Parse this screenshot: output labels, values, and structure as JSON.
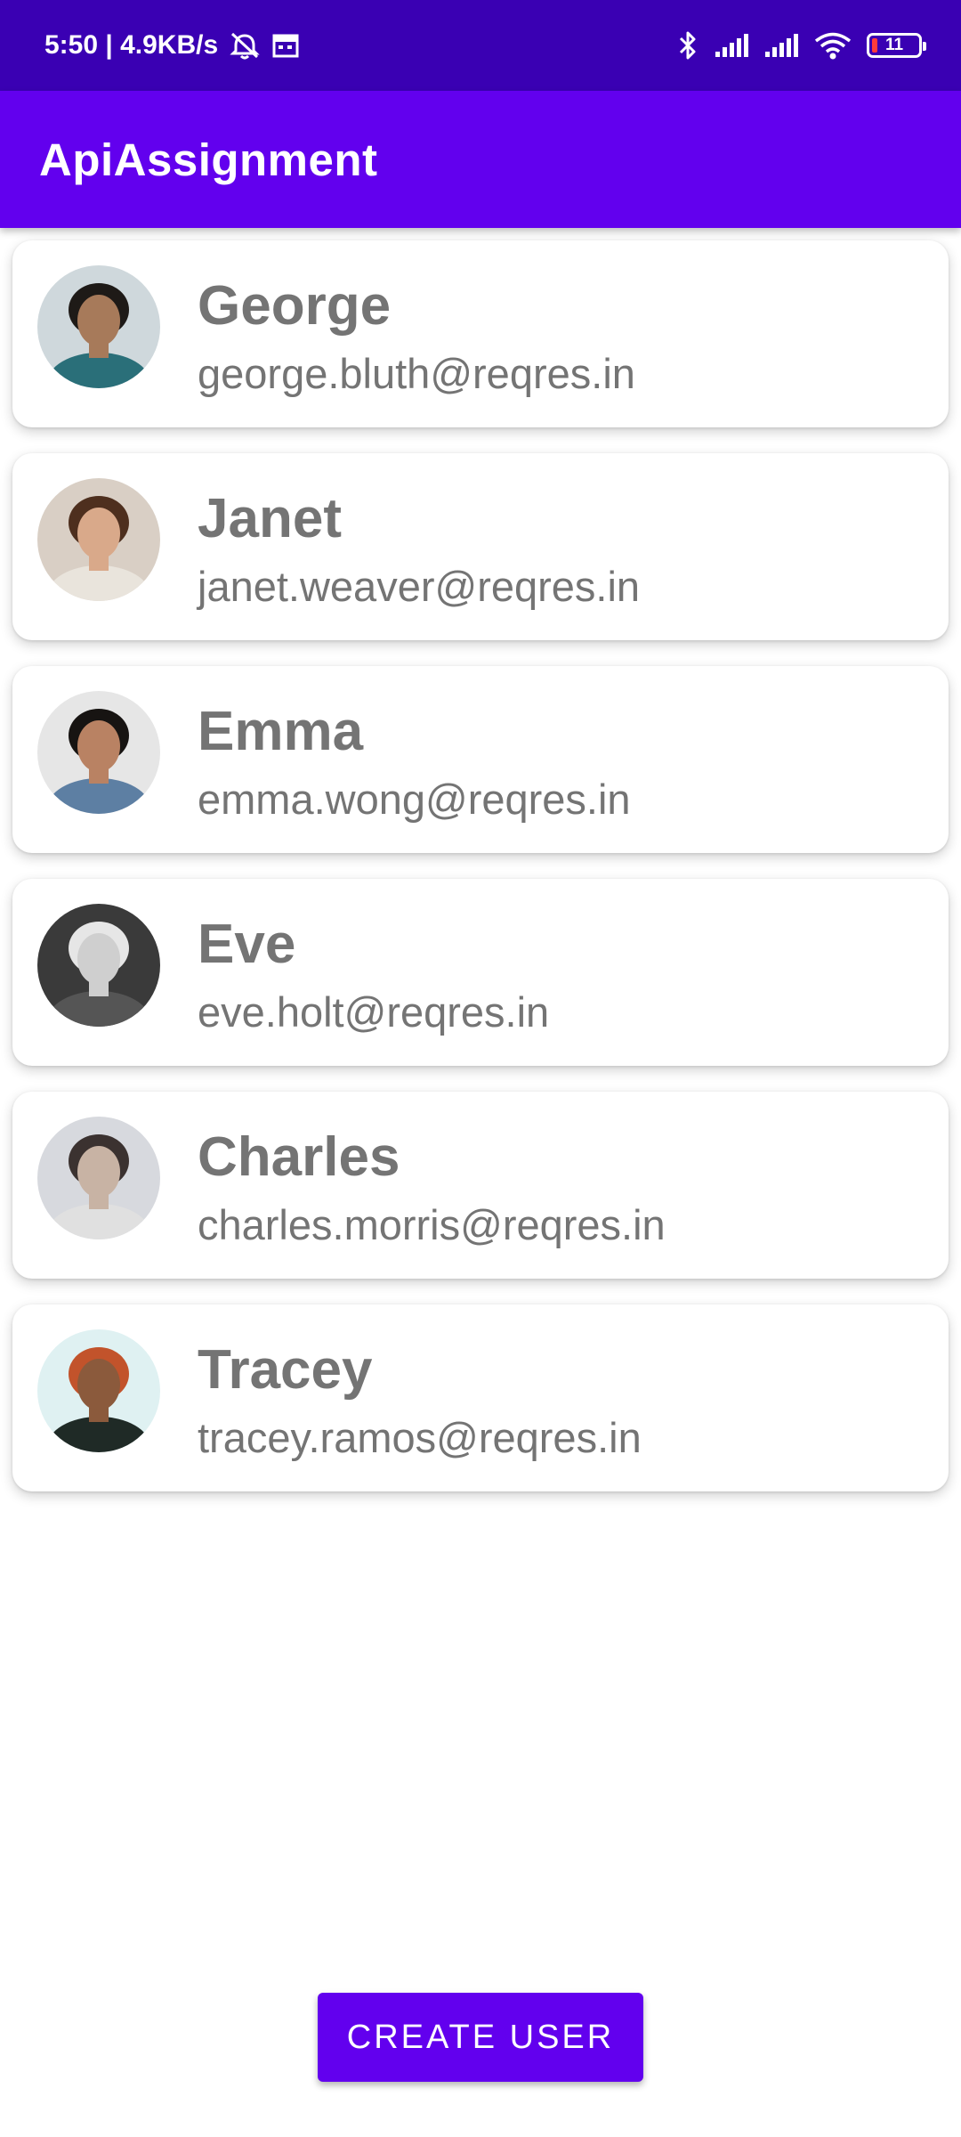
{
  "status_bar": {
    "time_speed": "5:50 | 4.9KB/s",
    "battery": "11",
    "icons": [
      "muted-alarm-icon",
      "calendar-icon",
      "bluetooth-icon",
      "signal-icon",
      "signal-icon",
      "wifi-icon",
      "battery-icon"
    ]
  },
  "app_bar": {
    "title": "ApiAssignment"
  },
  "users": [
    {
      "name": "George",
      "email": "george.bluth@reqres.in",
      "avatar_bg": "#cfd8dc",
      "skin": "#a77a5a",
      "hair": "#1e1a17",
      "shirt": "#2a6f79"
    },
    {
      "name": "Janet",
      "email": "janet.weaver@reqres.in",
      "avatar_bg": "#d9cfc5",
      "skin": "#d9a98a",
      "hair": "#4e2f1e",
      "shirt": "#e9e4dc"
    },
    {
      "name": "Emma",
      "email": "emma.wong@reqres.in",
      "avatar_bg": "#e6e6e6",
      "skin": "#b98263",
      "hair": "#171412",
      "shirt": "#5d7fa3"
    },
    {
      "name": "Eve",
      "email": "eve.holt@reqres.in",
      "avatar_bg": "#3a3a3a",
      "skin": "#cfcfcf",
      "hair": "#e6e6e6",
      "shirt": "#555555"
    },
    {
      "name": "Charles",
      "email": "charles.morris@reqres.in",
      "avatar_bg": "#d7d9de",
      "skin": "#c8b3a4",
      "hair": "#3b3230",
      "shirt": "#e0e0e0"
    },
    {
      "name": "Tracey",
      "email": "tracey.ramos@reqres.in",
      "avatar_bg": "#dff1f2",
      "skin": "#8b5a3c",
      "hair": "#c2532b",
      "shirt": "#1f2a26"
    }
  ],
  "create_button": {
    "label": "CREATE USER"
  },
  "colors": {
    "primary": "#6200ee",
    "status_bar": "#3a00b3",
    "text_gray": "#747474"
  }
}
